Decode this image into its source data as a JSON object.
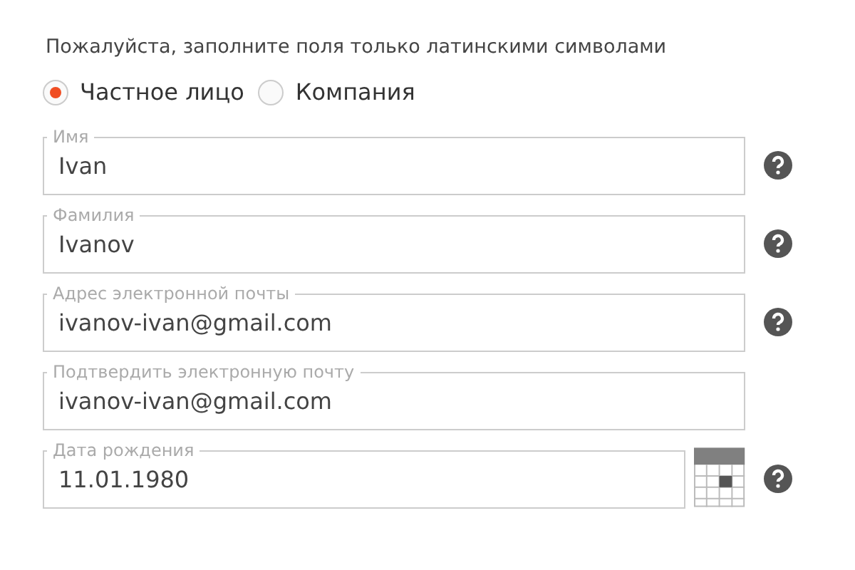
{
  "instruction": "Пожалуйста, заполните поля только латинскими символами",
  "person_type": [
    {
      "label": "Частное лицо",
      "selected": true
    },
    {
      "label": "Компания",
      "selected": false
    }
  ],
  "fields": [
    {
      "kind": "text",
      "label": "Имя",
      "value": "Ivan",
      "help": true
    },
    {
      "kind": "text",
      "label": "Фамилия",
      "value": "Ivanov",
      "help": true
    },
    {
      "kind": "text",
      "label": "Адрес электронной почты",
      "value": "ivanov-ivan@gmail.com",
      "help": true
    },
    {
      "kind": "text",
      "label": "Подтвердить электронную почту",
      "value": "ivanov-ivan@gmail.com",
      "help": false
    },
    {
      "kind": "date",
      "label": "Дата рождения",
      "value": "11.01.1980",
      "help": true
    }
  ]
}
